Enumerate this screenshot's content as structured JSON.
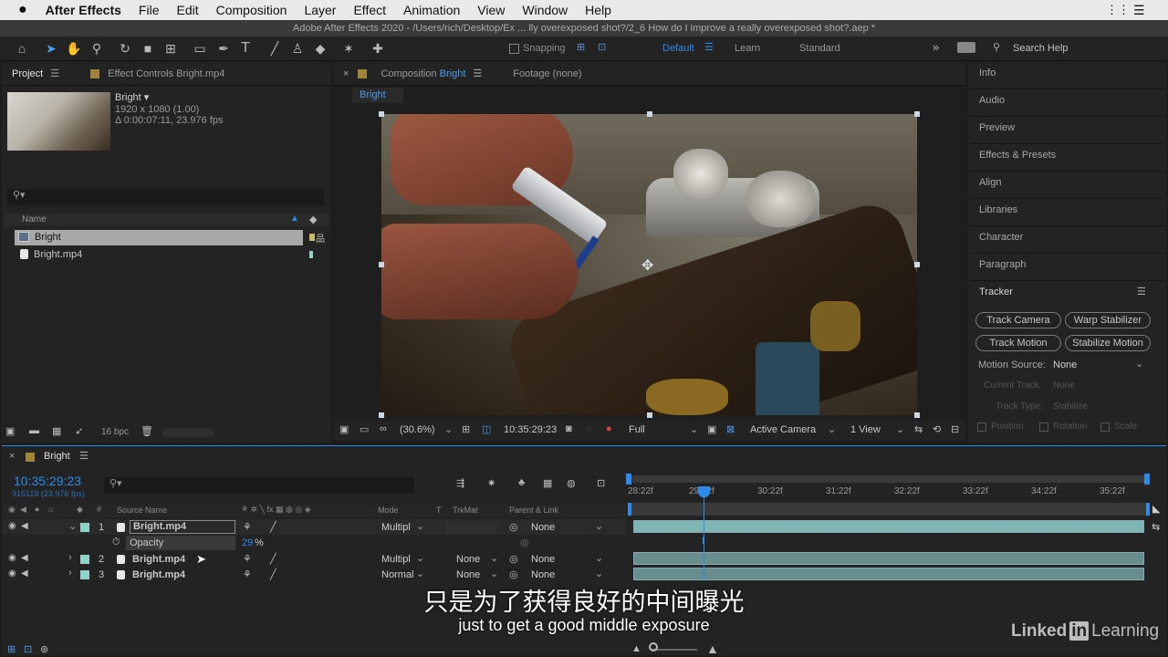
{
  "menubar": {
    "apple": "",
    "items": [
      "After Effects",
      "File",
      "Edit",
      "Composition",
      "Layer",
      "Effect",
      "Animation",
      "View",
      "Window",
      "Help"
    ]
  },
  "window_title": "Adobe After Effects 2020 - /Users/rich/Desktop/Ex ... lly overexposed shot?/2_6 How do I improve a really overexposed shot?.aep *",
  "toolbar": {
    "snapping": "Snapping",
    "workspaces": [
      "Default",
      "Learn",
      "Standard"
    ],
    "search_help": "Search Help"
  },
  "project": {
    "tab": "Project",
    "effect_controls": "Effect Controls Bright.mp4",
    "item_name": "Bright ▾",
    "item_res": "1920 x 1080 (1.00)",
    "item_dur": "Δ 0:00:07:11, 23.976 fps",
    "col_name": "Name",
    "items": [
      "Bright",
      "Bright.mp4"
    ],
    "bpc": "16 bpc"
  },
  "composition": {
    "tab_prefix": "Composition ",
    "tab_name": "Bright",
    "footage": "Footage (none)",
    "breadcrumb": "Bright",
    "zoom": "(30.6%)",
    "timecode": "10:35:29:23",
    "quality": "Full",
    "camera": "Active Camera",
    "views": "1 View"
  },
  "right": {
    "items": [
      "Info",
      "Audio",
      "Preview",
      "Effects & Presets",
      "Align",
      "Libraries",
      "Character",
      "Paragraph"
    ],
    "tracker": "Tracker",
    "buttons": [
      "Track Camera",
      "Warp Stabilizer",
      "Track Motion",
      "Stabilize Motion"
    ],
    "motion_source_label": "Motion Source:",
    "motion_source": "None",
    "current_track_label": "Current Track:",
    "current_track": "None",
    "track_type_label": "Track Type:",
    "track_type": "Stabilize",
    "checks": [
      "Position",
      "Rotation",
      "Scale"
    ]
  },
  "timeline": {
    "tab": "Bright",
    "timecode": "10:35:29:23",
    "fps": "915119 (23.976 fps)",
    "cols": {
      "source": "Source Name",
      "mode": "Mode",
      "t": "T",
      "trkmat": "TrkMat",
      "parent": "Parent & Link"
    },
    "layers": [
      {
        "num": "1",
        "name": "Bright.mp4",
        "mode": "Multipl",
        "trkmat": "",
        "parent": "None"
      },
      {
        "num": "2",
        "name": "Bright.mp4",
        "mode": "Multipl",
        "trkmat": "None",
        "parent": "None"
      },
      {
        "num": "3",
        "name": "Bright.mp4",
        "mode": "Normal",
        "trkmat": "None",
        "parent": "None"
      }
    ],
    "opacity_label": "Opacity",
    "opacity_value": "29",
    "opacity_unit": "%",
    "ruler": [
      "28:22f",
      "29:22f",
      "30:22f",
      "31:22f",
      "32:22f",
      "33:22f",
      "34:22f",
      "35:22f"
    ]
  },
  "subtitles": {
    "chinese": "只是为了获得良好的中间曝光",
    "english": "just to get a good middle exposure"
  },
  "watermark": {
    "a": "Linked",
    "b": "in",
    "c": "Learning"
  }
}
